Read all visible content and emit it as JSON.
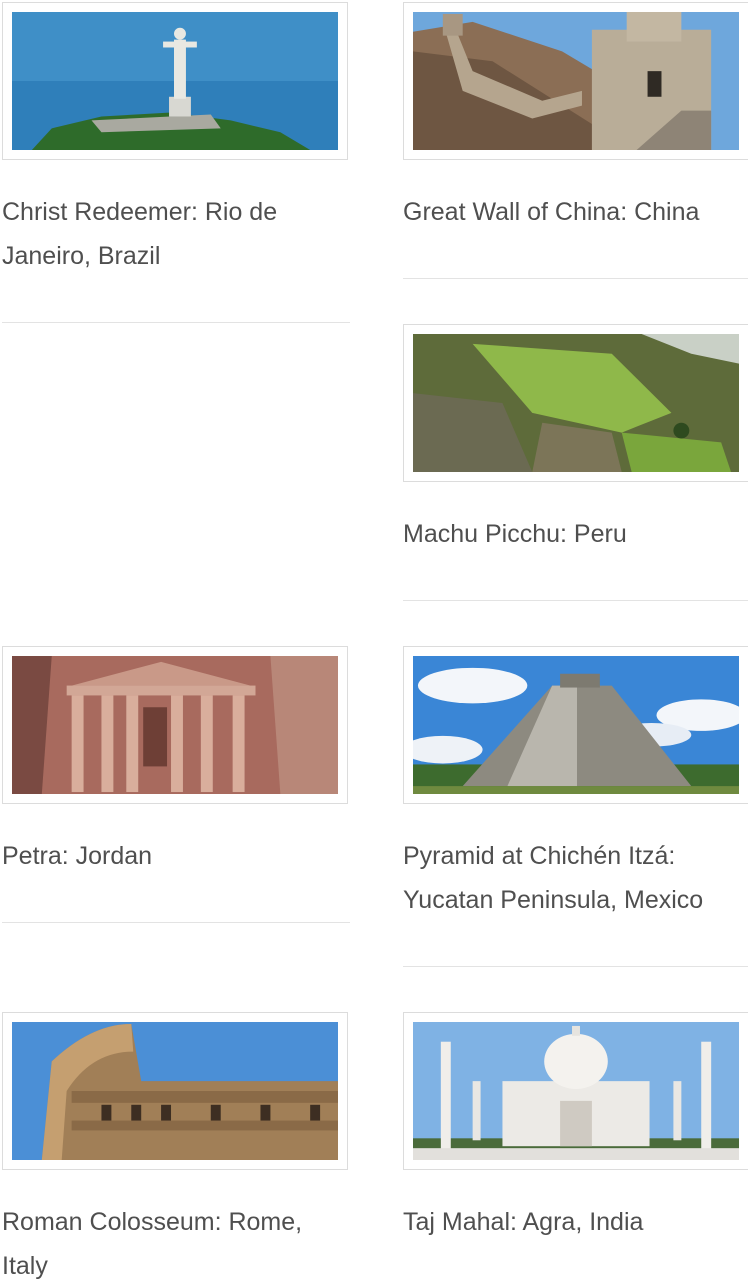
{
  "gallery": {
    "items": [
      {
        "caption": "Christ Redeemer: Rio de Janeiro, Brazil"
      },
      {
        "caption": "Great Wall of China: China"
      },
      {
        "caption": "Machu Picchu: Peru"
      },
      {
        "caption": "Petra: Jordan"
      },
      {
        "caption": "Pyramid at Chichén Itzá: Yucatan Peninsula, Mexico"
      },
      {
        "caption": "Roman Colosseum: Rome, Italy"
      },
      {
        "caption": "Taj Mahal: Agra, India"
      }
    ]
  },
  "colors": {
    "caption_text": "#4f4f4f",
    "divider": "#e3e3e3",
    "frame_border": "#dcdcdc"
  }
}
